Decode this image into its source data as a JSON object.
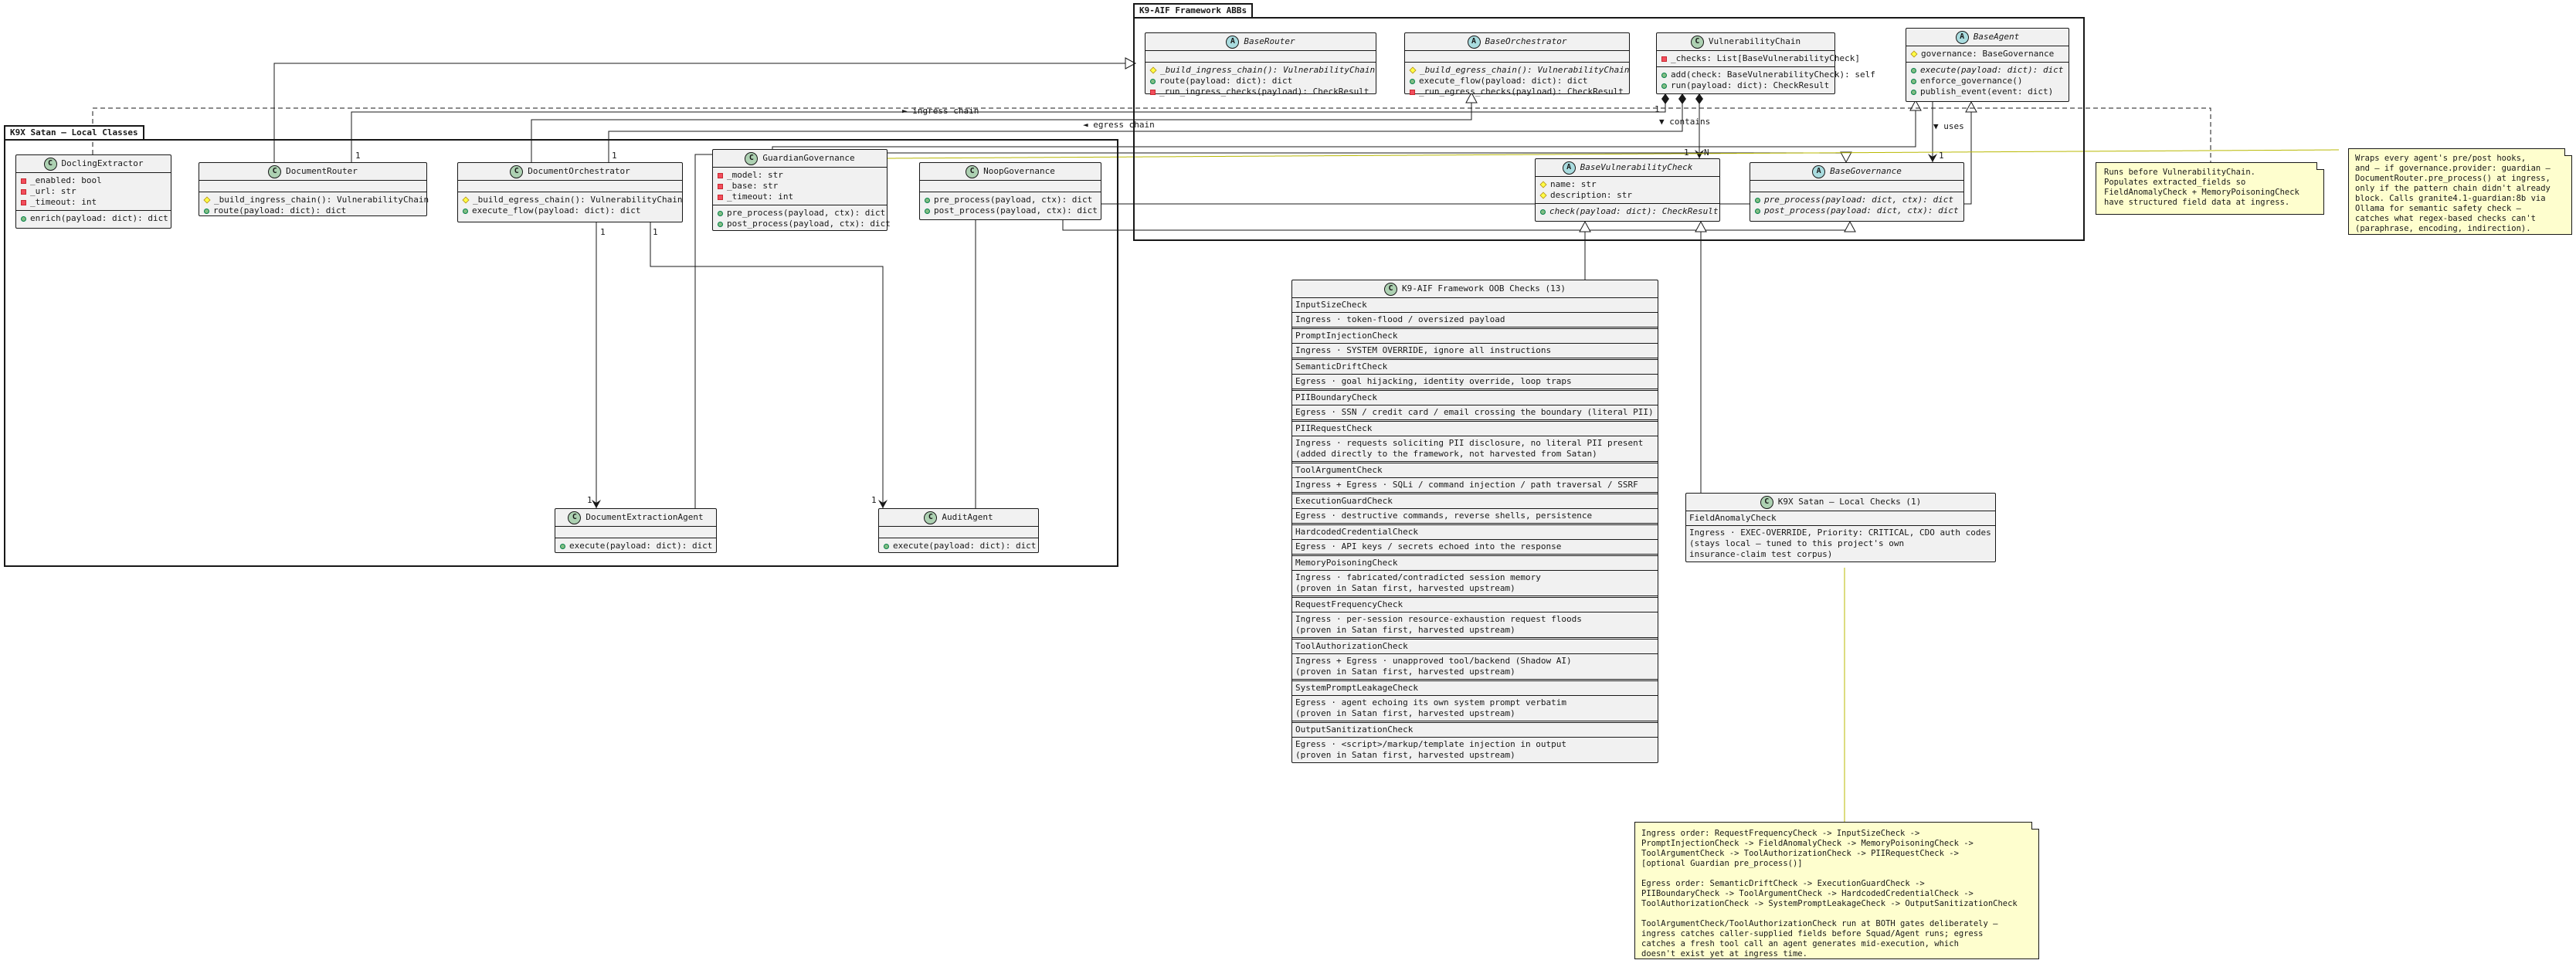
{
  "packages": {
    "framework": "K9-AIF Framework ABBs",
    "local": "K9X Satan – Local Classes"
  },
  "framework_classes": {
    "base_router": {
      "name": "BaseRouter",
      "members": [
        "_build_ingress_chain(): VulnerabilityChain",
        "route(payload: dict): dict",
        "_run_ingress_checks(payload): CheckResult"
      ]
    },
    "base_orchestrator": {
      "name": "BaseOrchestrator",
      "members": [
        "_build_egress_chain(): VulnerabilityChain",
        "execute_flow(payload: dict): dict",
        "_run_egress_checks(payload): CheckResult"
      ]
    },
    "vulnerability_chain": {
      "name": "VulnerabilityChain",
      "fields": [
        "_checks: List[BaseVulnerabilityCheck]"
      ],
      "methods": [
        "add(check: BaseVulnerabilityCheck): self",
        "run(payload: dict): CheckResult"
      ]
    },
    "base_agent": {
      "name": "BaseAgent",
      "fields": [
        "governance: BaseGovernance"
      ],
      "methods": [
        "execute(payload: dict): dict",
        "enforce_governance()",
        "publish_event(event: dict)"
      ]
    },
    "base_vulnerability_check": {
      "name": "BaseVulnerabilityCheck",
      "fields": [
        "name: str",
        "description: str"
      ],
      "methods": [
        "check(payload: dict): CheckResult"
      ]
    },
    "base_governance": {
      "name": "BaseGovernance",
      "methods": [
        "pre_process(payload: dict, ctx): dict",
        "post_process(payload: dict, ctx): dict"
      ]
    }
  },
  "local_classes": {
    "docling_extractor": {
      "name": "DoclingExtractor",
      "fields": [
        "_enabled: bool",
        "_url: str",
        "_timeout: int"
      ],
      "methods": [
        "enrich(payload: dict): dict"
      ]
    },
    "document_router": {
      "name": "DocumentRouter",
      "methods": [
        "_build_ingress_chain(): VulnerabilityChain",
        "route(payload: dict): dict"
      ]
    },
    "document_orchestrator": {
      "name": "DocumentOrchestrator",
      "methods": [
        "_build_egress_chain(): VulnerabilityChain",
        "execute_flow(payload: dict): dict"
      ]
    },
    "guardian_governance": {
      "name": "GuardianGovernance",
      "fields": [
        "_model: str",
        "_base: str",
        "_timeout: int"
      ],
      "methods": [
        "pre_process(payload, ctx): dict",
        "post_process(payload, ctx): dict"
      ]
    },
    "noop_governance": {
      "name": "NoopGovernance",
      "methods": [
        "pre_process(payload, ctx): dict",
        "post_process(payload, ctx): dict"
      ]
    },
    "document_extraction_agent": {
      "name": "DocumentExtractionAgent",
      "methods": [
        "execute(payload: dict): dict"
      ]
    },
    "audit_agent": {
      "name": "AuditAgent",
      "methods": [
        "execute(payload: dict): dict"
      ]
    }
  },
  "ootb_checks": {
    "title": "K9-AIF Framework OOB Checks (13)",
    "items": [
      {
        "name": "InputSizeCheck",
        "desc": "Ingress · token-flood / oversized payload"
      },
      {
        "name": "PromptInjectionCheck",
        "desc": "Ingress · SYSTEM OVERRIDE, ignore all instructions"
      },
      {
        "name": "SemanticDriftCheck",
        "desc": "Egress · goal hijacking, identity override, loop traps"
      },
      {
        "name": "PIIBoundaryCheck",
        "desc": "Egress · SSN / credit card / email crossing the boundary (literal PII)"
      },
      {
        "name": "PIIRequestCheck",
        "desc": "Ingress · requests soliciting PII disclosure, no literal PII present\n(added directly to the framework, not harvested from Satan)"
      },
      {
        "name": "ToolArgumentCheck",
        "desc": "Ingress + Egress · SQLi / command injection / path traversal / SSRF"
      },
      {
        "name": "ExecutionGuardCheck",
        "desc": "Egress · destructive commands, reverse shells, persistence"
      },
      {
        "name": "HardcodedCredentialCheck",
        "desc": "Egress · API keys / secrets echoed into the response"
      },
      {
        "name": "MemoryPoisoningCheck",
        "desc": "Ingress · fabricated/contradicted session memory\n(proven in Satan first, harvested upstream)"
      },
      {
        "name": "RequestFrequencyCheck",
        "desc": "Ingress · per-session resource-exhaustion request floods\n(proven in Satan first, harvested upstream)"
      },
      {
        "name": "ToolAuthorizationCheck",
        "desc": "Ingress + Egress · unapproved tool/backend (Shadow AI)\n(proven in Satan first, harvested upstream)"
      },
      {
        "name": "SystemPromptLeakageCheck",
        "desc": "Egress · agent echoing its own system prompt verbatim\n(proven in Satan first, harvested upstream)"
      },
      {
        "name": "OutputSanitizationCheck",
        "desc": "Egress · <script>/markup/template injection in output\n(proven in Satan first, harvested upstream)"
      }
    ]
  },
  "local_checks": {
    "title": "K9X Satan – Local Checks (1)",
    "items": [
      {
        "name": "FieldAnomalyCheck",
        "desc": "Ingress · EXEC-OVERRIDE, Priority: CRITICAL, CDO auth codes\n(stays local — tuned to this project's own\ninsurance-claim test corpus)"
      }
    ]
  },
  "notes": {
    "docling": "Runs before VulnerabilityChain.\nPopulates extracted_fields so\nFieldAnomalyCheck + MemoryPoisoningCheck\nhave structured field data at ingress.",
    "guardian": "Wraps every agent's pre/post hooks,\nand — if governance.provider: guardian —\nDocumentRouter.pre_process() at ingress,\nonly if the pattern chain didn't already\nblock. Calls granite4.1-guardian:8b via\nOllama for semantic safety check —\ncatches what regex-based checks can't\n(paraphrase, encoding, indirection).",
    "order": "Ingress order: RequestFrequencyCheck -> InputSizeCheck ->\nPromptInjectionCheck -> FieldAnomalyCheck -> MemoryPoisoningCheck ->\nToolArgumentCheck -> ToolAuthorizationCheck -> PIIRequestCheck ->\n[optional Guardian pre_process()]\n\nEgress order: SemanticDriftCheck -> ExecutionGuardCheck ->\nPIIBoundaryCheck -> ToolArgumentCheck -> HardcodedCredentialCheck ->\nToolAuthorizationCheck -> SystemPromptLeakageCheck -> OutputSanitizationCheck\n\nToolArgumentCheck/ToolAuthorizationCheck run at BOTH gates deliberately —\ningress catches caller-supplied fields before Squad/Agent runs; egress\ncatches a fresh tool call an agent generates mid-execution, which\ndoesn't exist yet at ingress time."
  },
  "edge_labels": {
    "ingress_chain": "► ingress chain",
    "egress_chain": "◄ egress chain",
    "contains": "▼ contains",
    "uses": "▼ uses",
    "mult_1a": "1",
    "mult_1b": "1",
    "mult_1c": "1",
    "mult_n": "N",
    "mult_1d": "1",
    "mult_1e": "1",
    "mult_1f": "1",
    "mult_1g": "1",
    "mult_1h": "1"
  }
}
